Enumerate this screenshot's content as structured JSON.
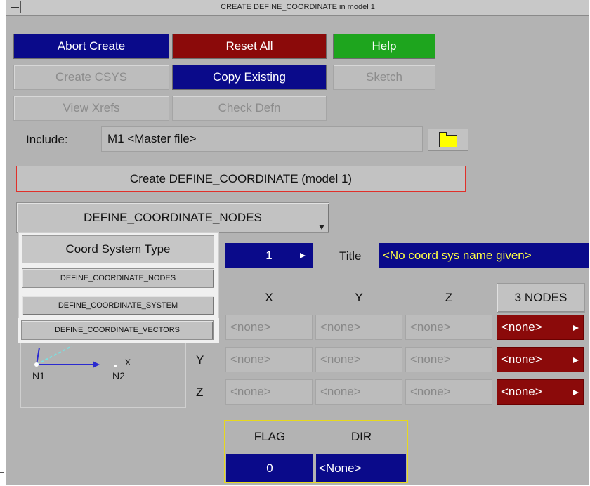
{
  "window": {
    "title": "CREATE DEFINE_COORDINATE in model 1"
  },
  "toolbar": {
    "abort": "Abort Create",
    "reset": "Reset All",
    "help": "Help",
    "create_csys": "Create CSYS",
    "copy_existing": "Copy Existing",
    "sketch": "Sketch",
    "view_xrefs": "View Xrefs",
    "check_defn": "Check Defn"
  },
  "include": {
    "label": "Include:",
    "value": "M1  <Master file>"
  },
  "create_bar": "Create DEFINE_COORDINATE (model 1)",
  "keyword_dropdown": {
    "selected": "DEFINE_COORDINATE_NODES"
  },
  "coord_type_popup": {
    "header": "Coord System Type",
    "options": [
      "DEFINE_COORDINATE_NODES",
      "DEFINE_COORDINATE_SYSTEM",
      "DEFINE_COORDINATE_VECTORS"
    ]
  },
  "id_field": {
    "value": "1"
  },
  "title_field": {
    "label": "Title",
    "value": "<No coord sys name given>"
  },
  "grid": {
    "headers": [
      "X",
      "Y",
      "Z",
      "3 NODES"
    ],
    "row_labels": [
      "Y",
      "Z"
    ],
    "rows": [
      [
        "<none>",
        "<none>",
        "<none>",
        "<none>"
      ],
      [
        "<none>",
        "<none>",
        "<none>",
        "<none>"
      ],
      [
        "<none>",
        "<none>",
        "<none>",
        "<none>"
      ]
    ]
  },
  "diagram": {
    "n1": "N1",
    "n2": "N2",
    "x": "X"
  },
  "flag": {
    "flag_label": "FLAG",
    "dir_label": "DIR",
    "flag_value": "0",
    "dir_value": "<None>"
  },
  "colors": {
    "blue": "#0a0a8a",
    "red": "#8b0a0a",
    "green": "#1ea51e",
    "yellow_text": "#ffff44",
    "bg": "#b3b3b3"
  }
}
